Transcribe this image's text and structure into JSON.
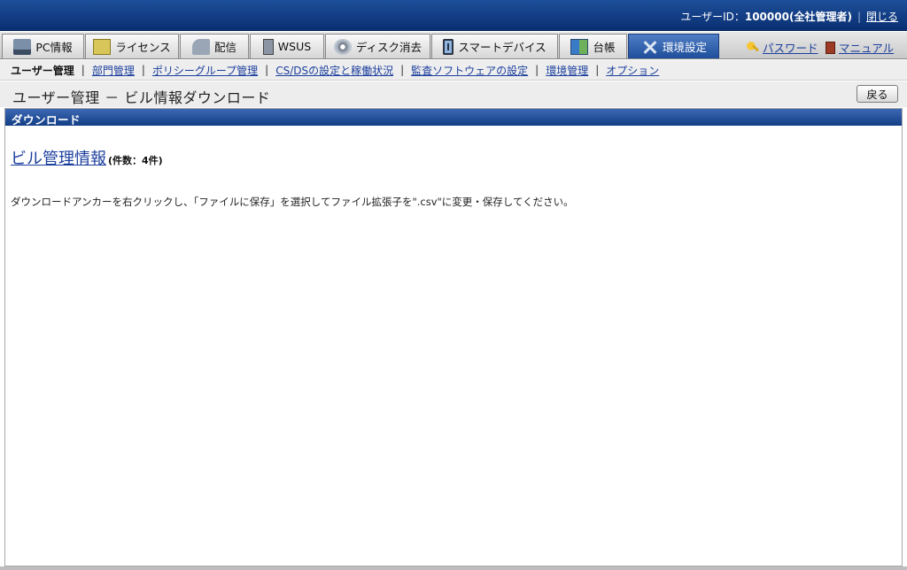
{
  "header": {
    "user_label": "ユーザーID：",
    "user_id": "100000(全社管理者)",
    "separator": "|",
    "close_label": "閉じる"
  },
  "tabs": [
    {
      "label": "PC情報",
      "icon": "pc-icon",
      "active": false
    },
    {
      "label": "ライセンス",
      "icon": "license-icon",
      "active": false
    },
    {
      "label": "配信",
      "icon": "distribution-icon",
      "active": false
    },
    {
      "label": "WSUS",
      "icon": "wsus-server-icon",
      "active": false
    },
    {
      "label": "ディスク消去",
      "icon": "disk-erase-icon",
      "active": false
    },
    {
      "label": "スマートデバイス",
      "icon": "smart-device-icon",
      "active": false
    },
    {
      "label": "台帳",
      "icon": "ledger-icon",
      "active": false
    },
    {
      "label": "環境設定",
      "icon": "tools-icon",
      "active": true
    }
  ],
  "side_links": {
    "password": "パスワード",
    "manual": "マニュアル"
  },
  "subnav": {
    "current": "ユーザー管理",
    "links": [
      "部門管理",
      "ポリシーグループ管理",
      "CS/DSの設定と稼働状況",
      "監査ソフトウェアの設定",
      "環境管理",
      "オプション"
    ],
    "separator": "|"
  },
  "page": {
    "title": "ユーザー管理 － ビル情報ダウンロード",
    "back_label": "戻る"
  },
  "panel": {
    "heading": "ダウンロード",
    "download_link": "ビル管理情報",
    "count": "(件数：4件)",
    "instruction": "ダウンロードアンカーを右クリックし、「ファイルに保存」を選択してファイル拡張子を\".csv\"に変更・保存してください。"
  },
  "colors": {
    "header_bg": "#0a2f72",
    "active_tab": "#1f4e9a",
    "link": "#1c3f9e",
    "panel_head": "#123e86"
  }
}
